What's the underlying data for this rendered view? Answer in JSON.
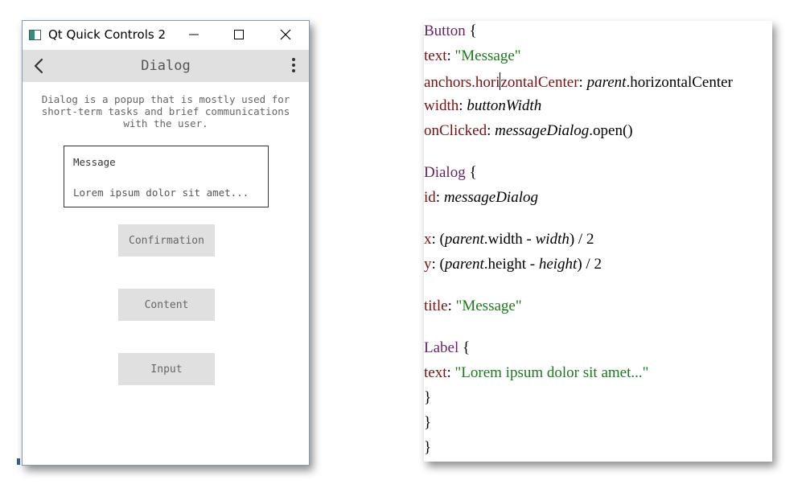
{
  "window": {
    "title": "Qt Quick Controls 2",
    "toolbar_title": "Dialog",
    "description": "Dialog is a popup that is mostly used for short-term tasks and brief communications with the user.",
    "dialog_preview": {
      "title": "Message",
      "text": "Lorem ipsum dolor sit amet..."
    },
    "buttons": {
      "confirmation": "Confirmation",
      "content": "Content",
      "input": "Input"
    },
    "icons": {
      "app": "app-icon",
      "minimize": "minimize-icon",
      "maximize": "maximize-icon",
      "close": "close-icon",
      "back": "back-arrow-icon",
      "menu": "more-vertical-icon"
    }
  },
  "code": {
    "l1": {
      "kw": "Button",
      "rest": " {"
    },
    "l2": {
      "prop": "text",
      "sep": ": ",
      "str": "\"Message\""
    },
    "l3": {
      "prop_a": "anchors.hori",
      "prop_b": "zontalCenter",
      "sep": ": ",
      "it": "parent",
      "plain": ".horizontalCenter"
    },
    "l4": {
      "prop": "width",
      "sep": ": ",
      "it": "buttonWidth"
    },
    "l5": {
      "prop": "onClicked",
      "sep": ": ",
      "it": "messageDialog",
      "plain": ".open()"
    },
    "l6": {
      "kw": "Dialog",
      "rest": " {"
    },
    "l7": {
      "prop": "id",
      "sep": ": ",
      "it": "messageDialog"
    },
    "l8": {
      "prop": "x",
      "a": ": (",
      "it1": "parent",
      "b": ".width - ",
      "it2": "width",
      "c": ") / 2"
    },
    "l9": {
      "prop": "y",
      "a": ": (",
      "it1": "parent",
      "b": ".height - ",
      "it2": "height",
      "c": ") / 2"
    },
    "l10": {
      "prop": "title",
      "sep": ": ",
      "str": "\"Message\""
    },
    "l11": {
      "kw": "Label",
      "rest": " {"
    },
    "l12": {
      "prop": "text",
      "sep": ": ",
      "str": "\"Lorem ipsum dolor sit amet...\""
    },
    "l13": "}",
    "l14": "}",
    "l15": "}"
  },
  "colors": {
    "toolbar_bg": "#e0e0e0",
    "button_bg": "#e0e0e0",
    "code_type": "#6a1f6a",
    "code_property": "#7a1010",
    "code_string": "#1a7a1a"
  }
}
